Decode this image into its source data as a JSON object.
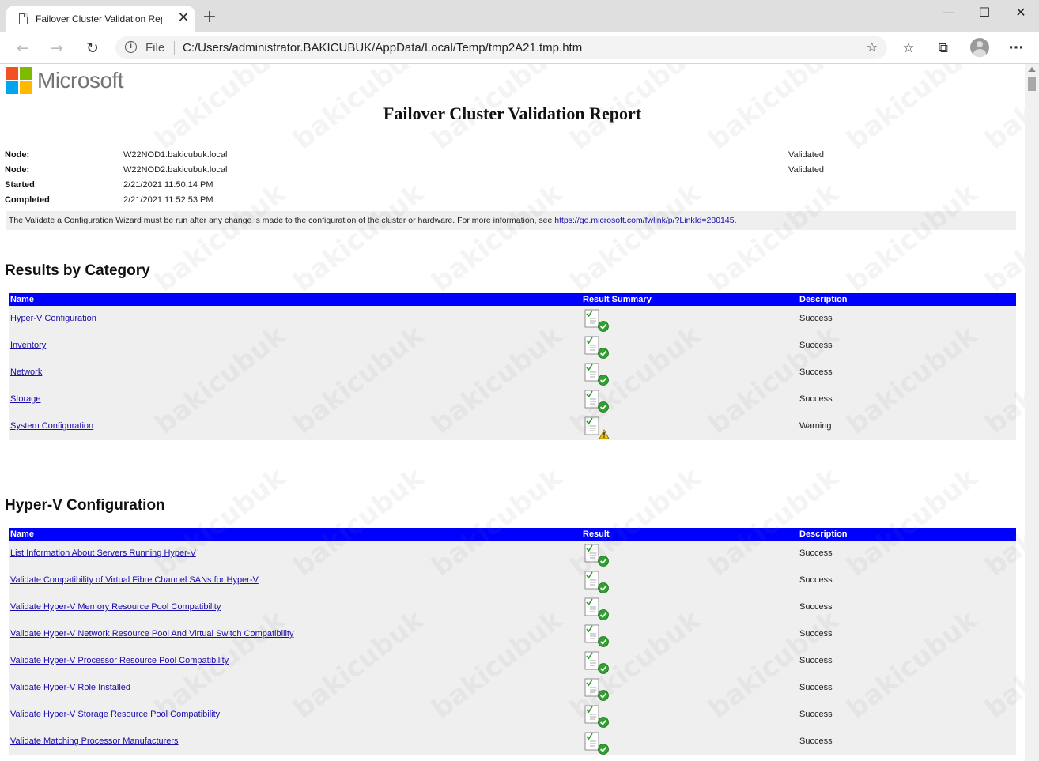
{
  "browser": {
    "tab_title": "Failover Cluster Validation Report",
    "tab_close": "✕",
    "new_tab": "+",
    "window_controls": {
      "minimize": "—",
      "maximize": "☐",
      "close": "✕"
    },
    "nav": {
      "back": "←",
      "forward": "→",
      "refresh": "↻"
    },
    "address_scheme": "File",
    "address_url": "C:/Users/administrator.BAKICUBUK/AppData/Local/Temp/tmp2A21.tmp.htm",
    "toolbar_icons": [
      "add-favorite-icon",
      "favorites-icon",
      "collections-icon",
      "profile-icon",
      "more-icon"
    ],
    "menu_glyph": "···"
  },
  "report": {
    "logo_text": "Microsoft",
    "logo_colors": [
      "#f25022",
      "#7fba00",
      "#00a4ef",
      "#ffb900"
    ],
    "title": "Failover Cluster Validation Report",
    "meta": [
      {
        "label": "Node:",
        "value": "W22NOD1.bakicubuk.local",
        "status": "Validated"
      },
      {
        "label": "Node:",
        "value": "W22NOD2.bakicubuk.local",
        "status": "Validated"
      },
      {
        "label": "Started",
        "value": "2/21/2021 11:50:14 PM",
        "status": ""
      },
      {
        "label": "Completed",
        "value": "2/21/2021 11:52:53 PM",
        "status": ""
      }
    ],
    "note_text": "The Validate a Configuration Wizard must be run after any change is made to the configuration of the cluster or hardware. For more information, see ",
    "note_link": "https://go.microsoft.com/fwlink/p/?LinkId=280145",
    "note_end": "."
  },
  "results_by_category": {
    "heading": "Results by Category",
    "columns": {
      "name": "Name",
      "result": "Result Summary",
      "description": "Description"
    },
    "rows": [
      {
        "name": "Hyper-V Configuration",
        "status": "success",
        "description": "Success"
      },
      {
        "name": "Inventory",
        "status": "success",
        "description": "Success"
      },
      {
        "name": "Network",
        "status": "success",
        "description": "Success"
      },
      {
        "name": "Storage",
        "status": "success",
        "description": "Success"
      },
      {
        "name": "System Configuration",
        "status": "warning",
        "description": "Warning"
      }
    ]
  },
  "hyperv_configuration": {
    "heading": "Hyper-V Configuration",
    "columns": {
      "name": "Name",
      "result": "Result",
      "description": "Description"
    },
    "rows": [
      {
        "name": "List Information About Servers Running Hyper-V",
        "status": "success",
        "description": "Success"
      },
      {
        "name": "Validate Compatibility of Virtual Fibre Channel SANs for Hyper-V",
        "status": "success",
        "description": "Success"
      },
      {
        "name": "Validate Hyper-V Memory Resource Pool Compatibility",
        "status": "success",
        "description": "Success"
      },
      {
        "name": "Validate Hyper-V Network Resource Pool And Virtual Switch Compatibility",
        "status": "success",
        "description": "Success"
      },
      {
        "name": "Validate Hyper-V Processor Resource Pool Compatibility",
        "status": "success",
        "description": "Success"
      },
      {
        "name": "Validate Hyper-V Role Installed",
        "status": "success",
        "description": "Success"
      },
      {
        "name": "Validate Hyper-V Storage Resource Pool Compatibility",
        "status": "success",
        "description": "Success"
      },
      {
        "name": "Validate Matching Processor Manufacturers",
        "status": "success",
        "description": "Success"
      }
    ]
  },
  "watermark": "bakicubuk",
  "colors": {
    "header_blue": "#0000ff",
    "row_gray": "#efefef",
    "link": "#1a0dab",
    "success": "#2fa12f",
    "warning": "#f5c400"
  }
}
